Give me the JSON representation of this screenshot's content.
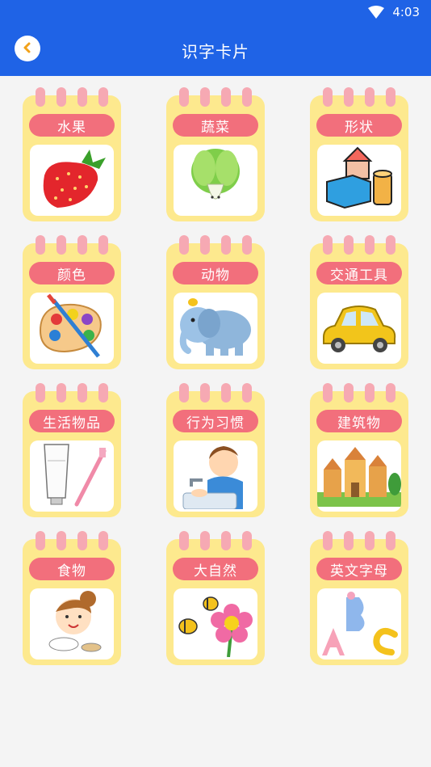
{
  "status": {
    "time": "4:03"
  },
  "header": {
    "title": "识字卡片"
  },
  "cards": [
    {
      "label": "水果",
      "icon": "strawberry-icon"
    },
    {
      "label": "蔬菜",
      "icon": "cabbage-icon"
    },
    {
      "label": "形状",
      "icon": "blocks-icon"
    },
    {
      "label": "颜色",
      "icon": "palette-icon"
    },
    {
      "label": "动物",
      "icon": "elephant-icon"
    },
    {
      "label": "交通工具",
      "icon": "car-icon"
    },
    {
      "label": "生活物品",
      "icon": "toothpaste-icon"
    },
    {
      "label": "行为习惯",
      "icon": "handwashing-icon"
    },
    {
      "label": "建筑物",
      "icon": "castle-icon"
    },
    {
      "label": "食物",
      "icon": "eating-girl-icon"
    },
    {
      "label": "大自然",
      "icon": "flower-bee-icon"
    },
    {
      "label": "英文字母",
      "icon": "abc-letters-icon"
    }
  ]
}
